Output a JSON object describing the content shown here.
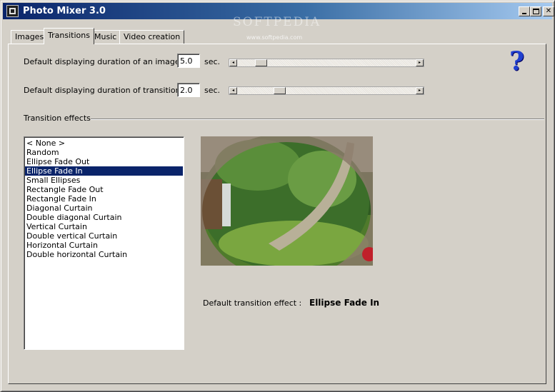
{
  "window": {
    "title": "Photo Mixer 3.0",
    "watermark": "SOFTPEDIA",
    "watermark_url": "www.softpedia.com",
    "close_glyph": "✕"
  },
  "tabs": [
    {
      "label": "Images",
      "active": false
    },
    {
      "label": "Transitions",
      "active": true
    },
    {
      "label": "Music",
      "active": false
    },
    {
      "label": "Video creation",
      "active": false
    }
  ],
  "settings": {
    "image_duration": {
      "label": "Default displaying duration of an image :",
      "value": "5.0",
      "unit": "sec."
    },
    "transition_duration": {
      "label": "Default displaying duration of transitions :",
      "value": "2.0",
      "unit": "sec."
    }
  },
  "transition_effects": {
    "group_label": "Transition effects",
    "items": [
      "< None >",
      "Random",
      "Ellipse Fade Out",
      "Ellipse Fade In",
      "Small Ellipses",
      "Rectangle Fade Out",
      "Rectangle Fade In",
      "Diagonal Curtain",
      "Double diagonal Curtain",
      "Vertical Curtain",
      "Double vertical Curtain",
      "Horizontal Curtain",
      "Double horizontal Curtain"
    ],
    "selected": "Ellipse Fade In"
  },
  "default_effect": {
    "label": "Default transition effect :",
    "value": "Ellipse Fade In"
  },
  "help": {
    "glyph": "?"
  }
}
